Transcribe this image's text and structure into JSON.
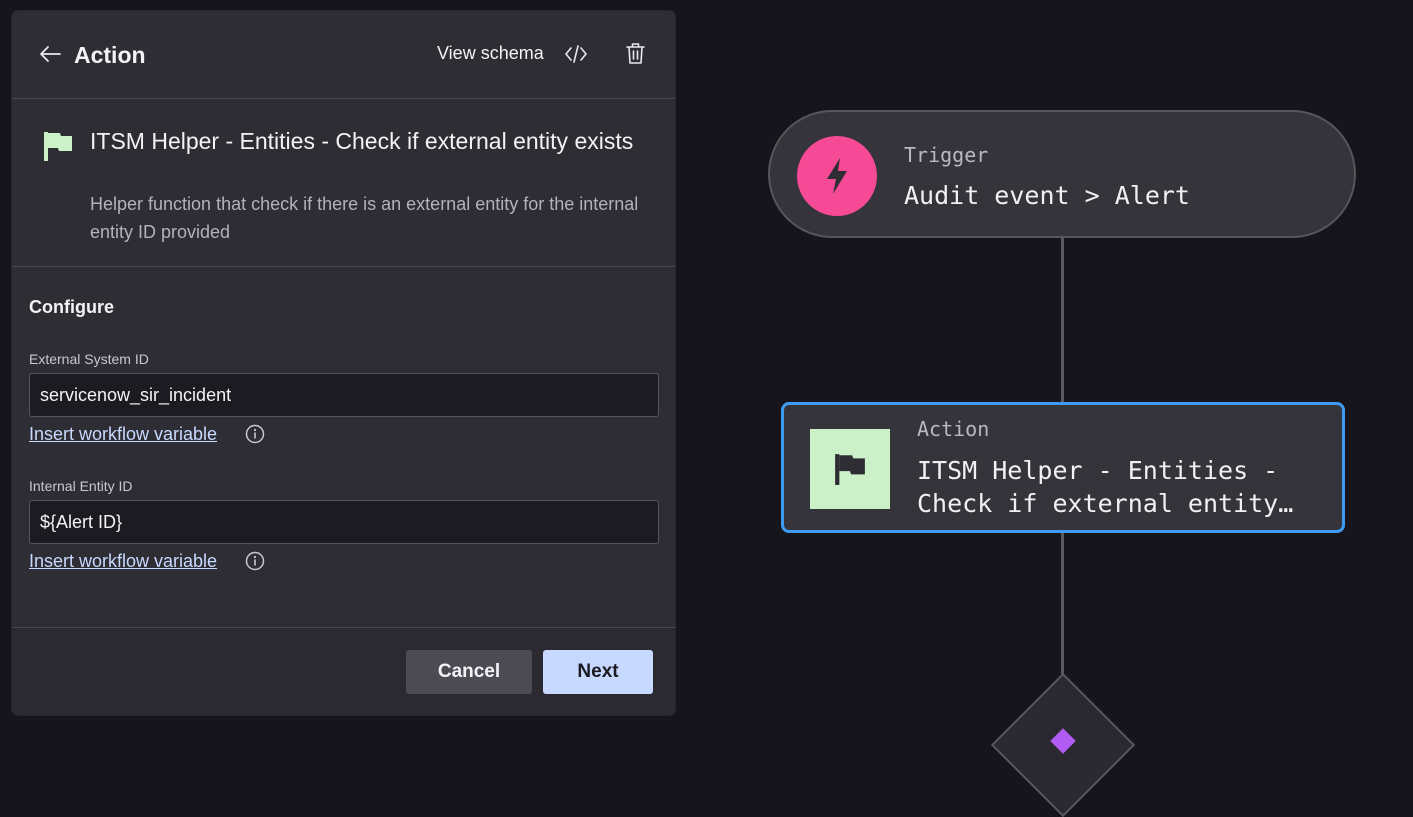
{
  "panel": {
    "header": {
      "title": "Action",
      "view_schema_label": "View schema"
    },
    "summary": {
      "title": "ITSM Helper - Entities - Check if external entity exists",
      "description": "Helper function that check if there is an external entity for the internal entity ID provided"
    },
    "configure": {
      "heading": "Configure",
      "fields": [
        {
          "label": "External System ID",
          "value": "servicenow_sir_incident",
          "link": "Insert workflow variable"
        },
        {
          "label": "Internal Entity ID",
          "value": "${Alert ID}",
          "link": "Insert workflow variable"
        }
      ]
    },
    "footer": {
      "cancel_label": "Cancel",
      "next_label": "Next"
    }
  },
  "canvas": {
    "trigger": {
      "label": "Trigger",
      "text": "Audit event > Alert"
    },
    "action": {
      "label": "Action",
      "line1": "ITSM Helper - Entities -",
      "line2": "Check if external entity…"
    }
  },
  "icons": {
    "back": "arrow-left-icon",
    "schema": "code-brackets-icon",
    "delete": "trash-icon",
    "action": "flag-icon",
    "trigger": "lightning-bolt-icon",
    "info": "info-circle-icon"
  },
  "colors": {
    "trigger_accent": "#f64a96",
    "action_accent": "#ccf1c8",
    "selected_border": "#3d9bf2",
    "primary_button": "#c7d9ff",
    "link": "#c8d9ff",
    "branch_marker": "#b05cf2"
  }
}
